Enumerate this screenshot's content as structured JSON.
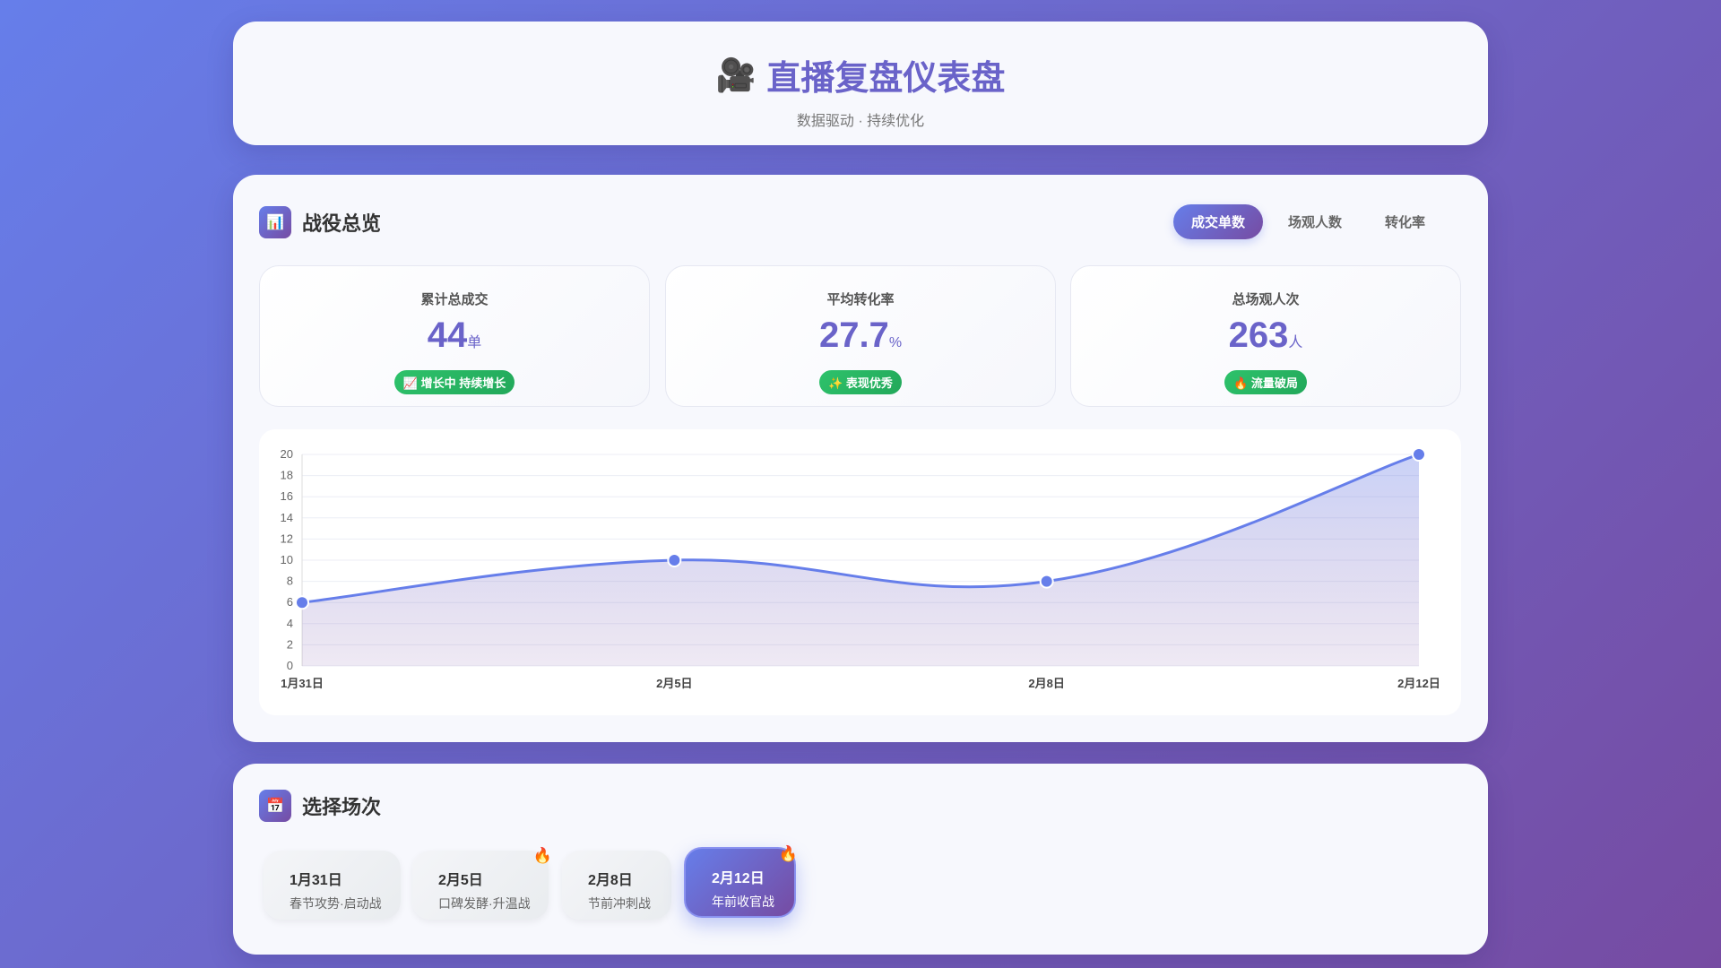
{
  "header": {
    "title": "直播复盘仪表盘",
    "subtitle": "数据驱动 · 持续优化"
  },
  "overview": {
    "title": "战役总览",
    "tabs": [
      {
        "label": "成交单数",
        "active": true
      },
      {
        "label": "场观人数",
        "active": false
      },
      {
        "label": "转化率",
        "active": false
      }
    ],
    "stats": [
      {
        "label": "累计总成交",
        "value": "44",
        "unit": "单",
        "badge": "📈 增长中 持续增长"
      },
      {
        "label": "平均转化率",
        "value": "27.7",
        "unit": "%",
        "badge": "✨ 表现优秀"
      },
      {
        "label": "总场观人次",
        "value": "263",
        "unit": "人",
        "badge": "🔥 流量破局"
      }
    ]
  },
  "chart_data": {
    "type": "area",
    "categories": [
      "1月31日",
      "2月5日",
      "2月8日",
      "2月12日"
    ],
    "values": [
      6,
      10,
      8,
      20
    ],
    "ylim": [
      0,
      20
    ],
    "yticks": [
      "0",
      "2",
      "4",
      "6",
      "8",
      "10",
      "12",
      "14",
      "16",
      "18",
      "20"
    ],
    "series_color": "#667eea",
    "grid": true
  },
  "sessions": {
    "title": "选择场次",
    "items": [
      {
        "date": "1月31日",
        "name": "春节攻势·启动战",
        "hot": false,
        "active": false
      },
      {
        "date": "2月5日",
        "name": "口碑发酵·升温战",
        "hot": true,
        "active": false
      },
      {
        "date": "2月8日",
        "name": "节前冲刺战",
        "hot": false,
        "active": false
      },
      {
        "date": "2月12日",
        "name": "年前收官战",
        "hot": true,
        "active": true
      }
    ]
  }
}
